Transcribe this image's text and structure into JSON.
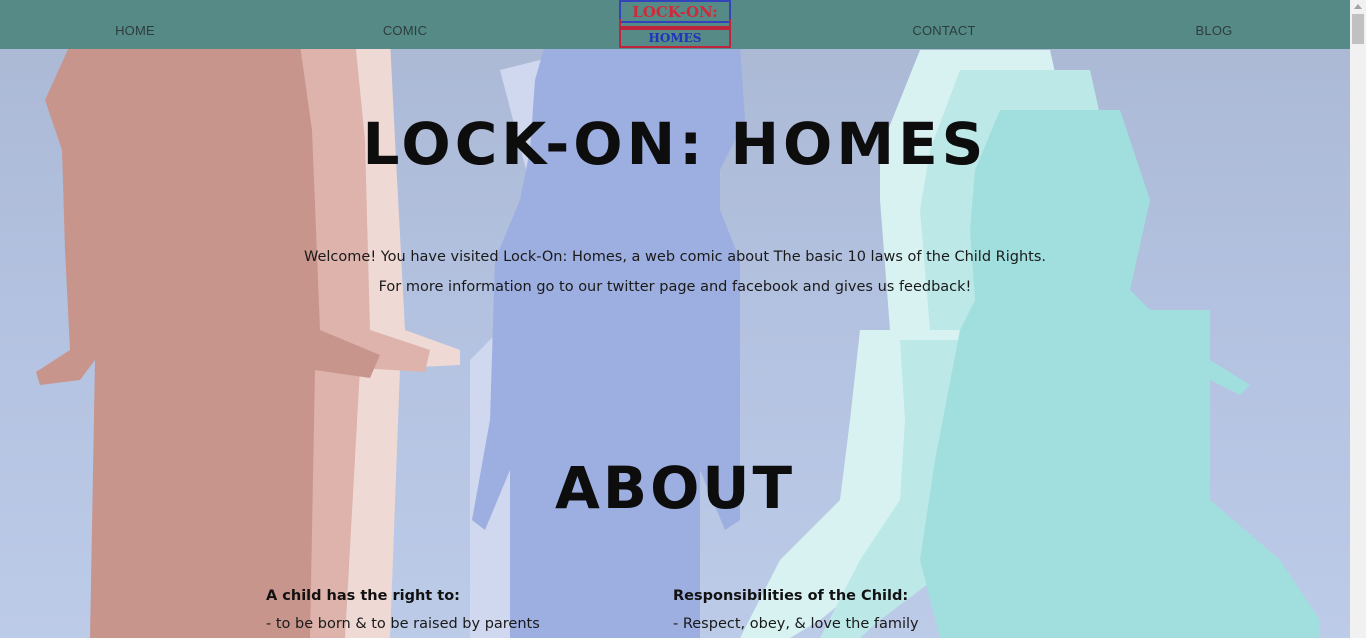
{
  "nav": {
    "items": [
      "HOME",
      "COMIC",
      "CONTACT",
      "BLOG"
    ],
    "logo": {
      "top": "LOCK-ON:",
      "bottom": "HOMES"
    }
  },
  "hero": {
    "title": "LOCK-ON: HOMES",
    "line1": "Welcome! You have visited Lock-On: Homes, a web comic about The basic 10 laws of the Child Rights.",
    "line2": "For more information go to our twitter page and facebook and gives us feedback!"
  },
  "about": {
    "title": "ABOUT",
    "rights": {
      "heading": "A child has the right to:",
      "items": [
        "- to be born & to be raised by parents"
      ]
    },
    "responsibilities": {
      "heading": "Responsibilities of the Child:",
      "items": [
        "- Respect, obey, & love the family"
      ]
    }
  },
  "colors": {
    "navbar": "#558a86",
    "background": "#b3c2e0",
    "silhouette_red": "#c8958c",
    "silhouette_blue": "#9daee0",
    "silhouette_teal": "#a1dfde"
  }
}
